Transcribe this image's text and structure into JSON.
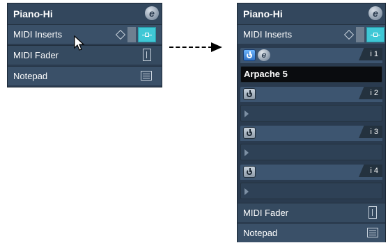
{
  "left_panel": {
    "title": "Piano-Hi",
    "edit_icon": "e",
    "rows": [
      {
        "label": "MIDI Inserts"
      },
      {
        "label": "MIDI Fader"
      },
      {
        "label": "Notepad"
      }
    ]
  },
  "right_panel": {
    "title": "Piano-Hi",
    "edit_icon": "e",
    "midi_inserts_label": "MIDI Inserts",
    "slots": [
      {
        "index": "i 1",
        "plugin": "Arpache 5",
        "edit_icon": "e"
      },
      {
        "index": "i 2",
        "plugin": ""
      },
      {
        "index": "i 3",
        "plugin": ""
      },
      {
        "index": "i 4",
        "plugin": ""
      }
    ],
    "midi_fader_label": "MIDI Fader",
    "notepad_label": "Notepad"
  },
  "colors": {
    "panel_bg": "#2a3b4f",
    "accent_cyan": "#3fc8d6",
    "power_on": "#2e6fc2"
  },
  "icons": [
    "edit-e-icon",
    "diamond-icon",
    "insert-bypass-icon",
    "fader-icon",
    "notepad-icon",
    "power-icon",
    "play-arrow-icon",
    "mouse-cursor-icon",
    "dashed-arrow"
  ]
}
